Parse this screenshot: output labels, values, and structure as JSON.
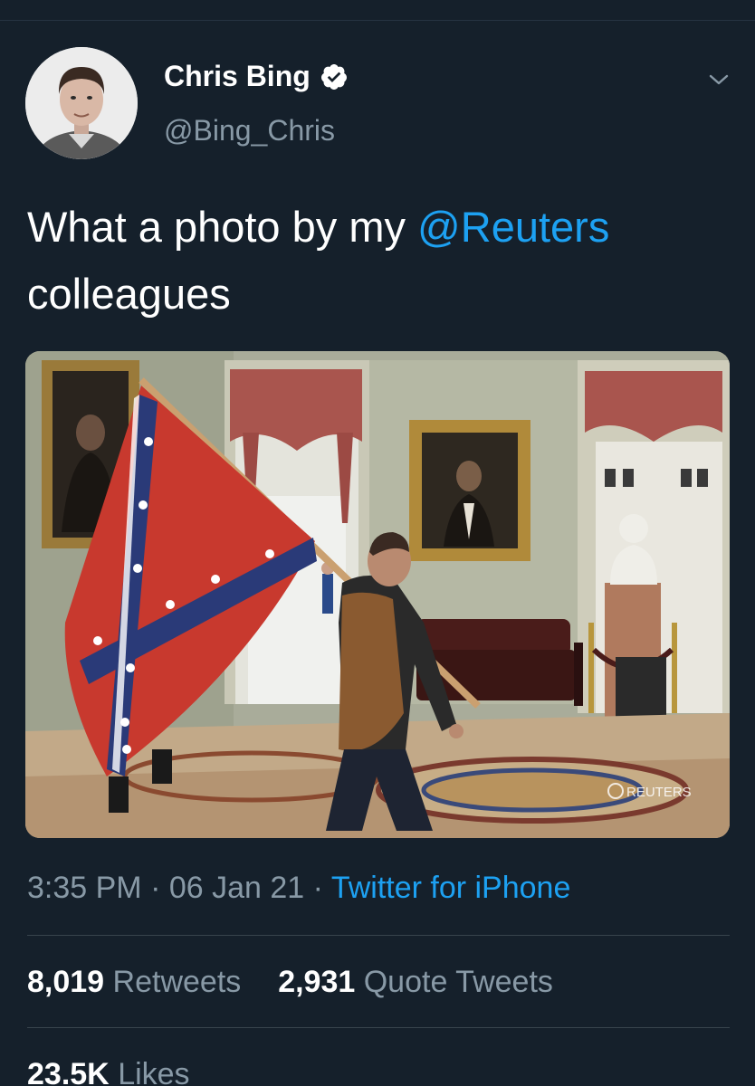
{
  "author": {
    "display_name": "Chris Bing",
    "handle": "@Bing_Chris"
  },
  "tweet": {
    "text_before": "What a photo by my ",
    "mention": "@Reuters",
    "text_after": "colleagues"
  },
  "media": {
    "watermark": "REUTERS"
  },
  "meta": {
    "time": "3:35 PM",
    "sep1": " · ",
    "date": "06 Jan 21",
    "sep2": " · ",
    "source": "Twitter for iPhone"
  },
  "stats": {
    "retweets_count": "8,019",
    "retweets_label": "Retweets",
    "quotes_count": "2,931",
    "quotes_label": "Quote Tweets",
    "likes_count": "23.5K",
    "likes_label": "Likes"
  },
  "colors": {
    "background": "#15202b",
    "accent": "#1da1f2",
    "secondary_text": "#8899a6"
  },
  "icons": {
    "verified": "verified-badge-icon",
    "menu": "chevron-down-icon"
  }
}
